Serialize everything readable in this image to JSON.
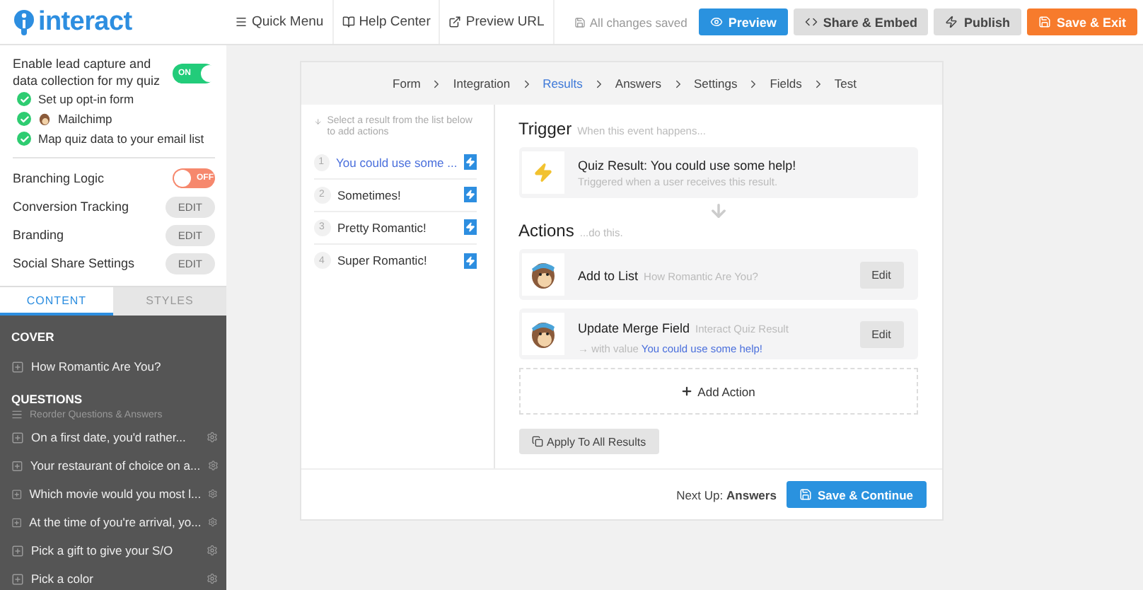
{
  "header": {
    "logo": "interact",
    "nav": [
      "Quick Menu",
      "Help Center",
      "Preview URL"
    ],
    "save_status": "All changes saved",
    "buttons": [
      {
        "label": "Preview",
        "kind": "primary"
      },
      {
        "label": "Share & Embed",
        "kind": "secondary"
      },
      {
        "label": "Publish",
        "kind": "secondary"
      },
      {
        "label": "Save & Exit",
        "kind": "accent"
      }
    ]
  },
  "sidebar": {
    "lead_capture": {
      "label": "Enable lead capture and data collection for my quiz",
      "on": true,
      "toggle_label": "ON"
    },
    "checklist": [
      {
        "label": "Set up opt-in form",
        "kind": "step"
      },
      {
        "label": "Mailchimp",
        "kind": "integration"
      },
      {
        "label": "Map quiz data to your email list",
        "kind": "step"
      }
    ],
    "settings": [
      {
        "label": "Branching Logic",
        "kind": "toggle",
        "on": false,
        "toggle_label": "OFF"
      },
      {
        "label": "Conversion Tracking",
        "kind": "edit",
        "button": "EDIT"
      },
      {
        "label": "Branding",
        "kind": "edit",
        "button": "EDIT"
      },
      {
        "label": "Social Share Settings",
        "kind": "edit",
        "button": "EDIT"
      }
    ],
    "tabs": [
      {
        "label": "CONTENT",
        "selected": true
      },
      {
        "label": "STYLES",
        "selected": false
      }
    ],
    "cover": {
      "title": "COVER",
      "items": [
        "How Romantic Are You?"
      ]
    },
    "questions": {
      "title": "QUESTIONS",
      "reorder": "Reorder Questions & Answers",
      "items": [
        "On a first date, you'd rather...",
        "Your restaurant of choice on a...",
        "Which movie would you most l...",
        "At the time of you're arrival, yo...",
        "Pick a gift to give your S/O",
        "Pick a color"
      ]
    }
  },
  "breadcrumbs": [
    {
      "label": "Form",
      "selected": false
    },
    {
      "label": "Integration",
      "selected": false
    },
    {
      "label": "Results",
      "selected": true
    },
    {
      "label": "Answers",
      "selected": false
    },
    {
      "label": "Settings",
      "selected": false
    },
    {
      "label": "Fields",
      "selected": false
    },
    {
      "label": "Test",
      "selected": false
    }
  ],
  "results": {
    "hint": "Select a result from the list below to add actions",
    "items": [
      {
        "number": "1",
        "label": "You could use some ...",
        "selected": true
      },
      {
        "number": "2",
        "label": "Sometimes!",
        "selected": false
      },
      {
        "number": "3",
        "label": "Pretty Romantic!",
        "selected": false
      },
      {
        "number": "4",
        "label": "Super Romantic!",
        "selected": false
      }
    ]
  },
  "trigger": {
    "title": "Trigger",
    "subtitle": "When this event happens...",
    "card_title": "Quiz Result: You could use some help!",
    "card_text": "Triggered when a user receives this result."
  },
  "actions": {
    "title": "Actions",
    "subtitle": "...do this.",
    "items": [
      {
        "title": "Add to List",
        "detail": "How Romantic Are You?",
        "button": "Edit"
      },
      {
        "title": "Update Merge Field",
        "detail": "Interact Quiz Result",
        "prefix": "→ with value",
        "value": "You could use some help!",
        "button": "Edit"
      }
    ],
    "add": "Add Action",
    "apply": "Apply To All Results"
  },
  "footer": {
    "next_label": "Next Up:",
    "next_value": "Answers",
    "button": "Save & Continue"
  }
}
